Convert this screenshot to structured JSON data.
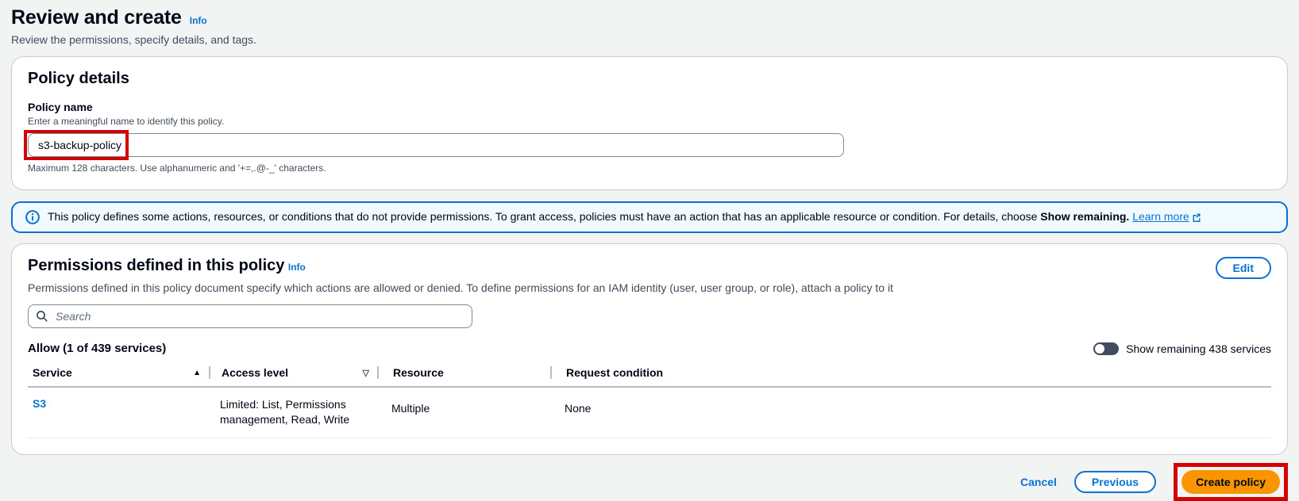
{
  "page": {
    "title": "Review and create",
    "title_info": "Info",
    "subtitle": "Review the permissions, specify details, and tags."
  },
  "policy_details": {
    "heading": "Policy details",
    "name_label": "Policy name",
    "name_description": "Enter a meaningful name to identify this policy.",
    "name_value": "s3-backup-policy",
    "name_constraint": "Maximum 128 characters. Use alphanumeric and '+=,.@-_' characters."
  },
  "info_banner": {
    "text_before": "This policy defines some actions, resources, or conditions that do not provide permissions. To grant access, policies must have an action that has an applicable resource or condition. For details, choose",
    "bold_text": "Show remaining.",
    "link_text": "Learn more"
  },
  "permissions": {
    "heading": "Permissions defined in this policy",
    "heading_info": "Info",
    "edit_button": "Edit",
    "description": "Permissions defined in this policy document specify which actions are allowed or denied. To define permissions for an IAM identity (user, user group, or role), attach a policy to it",
    "search_placeholder": "Search",
    "allow_summary": "Allow (1 of 439 services)",
    "toggle_label": "Show remaining 438 services",
    "table": {
      "columns": [
        "Service",
        "Access level",
        "Resource",
        "Request condition"
      ],
      "rows": [
        {
          "service": "S3",
          "access_level": "Limited: List, Permissions management, Read, Write",
          "resource": "Multiple",
          "request_condition": "None"
        }
      ]
    }
  },
  "footer": {
    "cancel": "Cancel",
    "previous": "Previous",
    "create": "Create policy"
  },
  "icons": {
    "sort_ascending": "▲",
    "filter": "▽"
  },
  "colors": {
    "link_blue": "#0972d3",
    "banner_bg": "#f1faff",
    "primary_orange": "#f89500",
    "annotation_red": "#d50000"
  }
}
